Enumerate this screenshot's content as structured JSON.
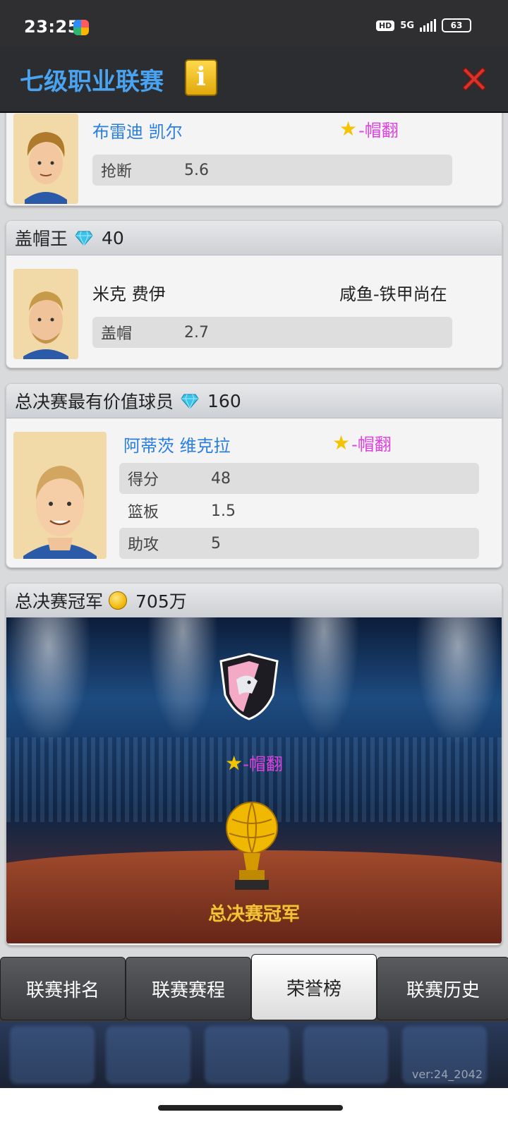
{
  "status_bar": {
    "time": "23:25",
    "hd_label": "HD",
    "network": "5G",
    "battery": "63"
  },
  "header": {
    "title": "七级职业联赛",
    "info_icon": "info-icon",
    "close_icon": "close-icon"
  },
  "awards": {
    "steals": {
      "player_name": "布雷迪 凯尔",
      "team": "-帽翻",
      "team_starred": true,
      "stats": [
        {
          "label": "抢断",
          "value": "5.6"
        }
      ]
    },
    "blocks_king": {
      "title": "盖帽王",
      "reward": "40",
      "reward_icon": "diamond-icon",
      "player_name": "米克 费伊",
      "team": "咸鱼-铁甲尚在",
      "stats": [
        {
          "label": "盖帽",
          "value": "2.7"
        }
      ]
    },
    "finals_mvp": {
      "title": "总决赛最有价值球员",
      "reward": "160",
      "reward_icon": "diamond-icon",
      "player_name": "阿蒂茨 维克拉",
      "team": "-帽翻",
      "team_starred": true,
      "stats": [
        {
          "label": "得分",
          "value": "48"
        },
        {
          "label": "篮板",
          "value": "1.5"
        },
        {
          "label": "助攻",
          "value": "5"
        }
      ]
    },
    "champion": {
      "title": "总决赛冠军",
      "reward": "705万",
      "reward_icon": "coin-icon",
      "team": "-帽翻",
      "trophy_label": "总决赛冠军"
    }
  },
  "tabs": [
    {
      "label": "联赛排名",
      "active": false
    },
    {
      "label": "联赛赛程",
      "active": false
    },
    {
      "label": "荣誉榜",
      "active": true
    },
    {
      "label": "联赛历史",
      "active": false
    }
  ],
  "version": "ver:24_2042",
  "colors": {
    "title_blue": "#4aa3f0",
    "player_blue": "#2a7de1",
    "team_magenta": "#e040e0",
    "star_yellow": "#f5c400"
  }
}
